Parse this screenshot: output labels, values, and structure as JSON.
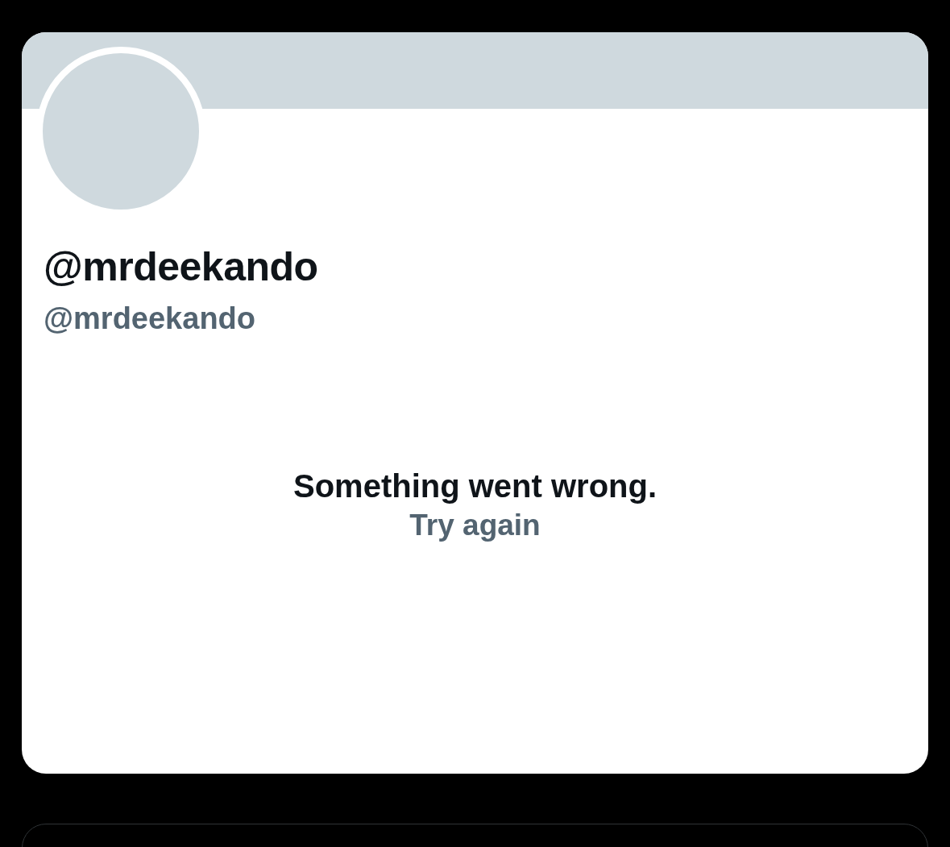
{
  "profile": {
    "display_name": "@mrdeekando",
    "handle": "@mrdeekando"
  },
  "error": {
    "message": "Something went wrong.",
    "retry_label": "Try again"
  }
}
